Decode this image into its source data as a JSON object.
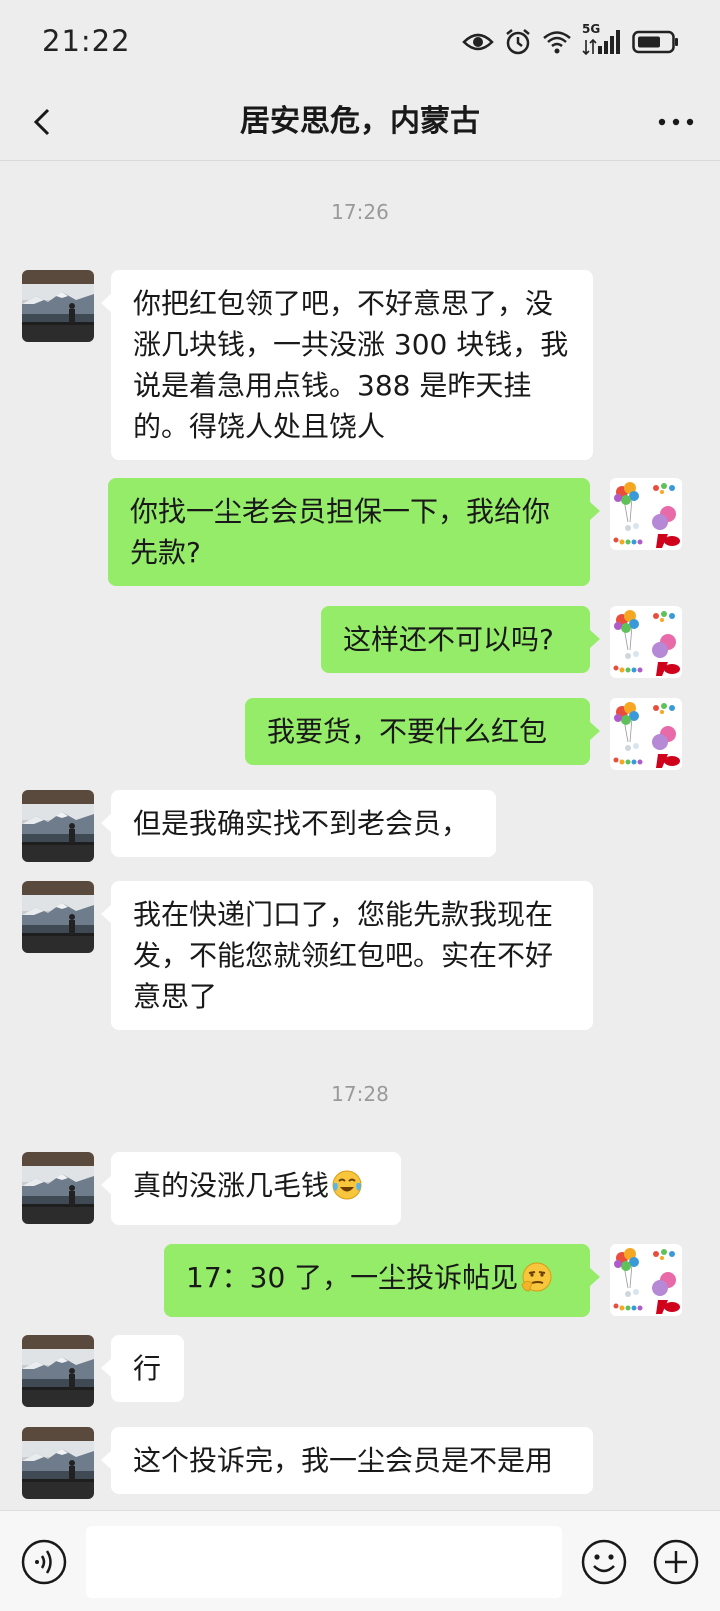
{
  "status_bar": {
    "time": "21:22",
    "network": "5G",
    "icons": [
      "eye-icon",
      "alarm-icon",
      "wifi-icon",
      "signal-icon",
      "battery-icon"
    ]
  },
  "header": {
    "title": "居安思危，内蒙古",
    "back_icon": "chevron-left-icon",
    "more_icon": "more-dots-icon"
  },
  "timestamps": [
    "17:26",
    "17:28"
  ],
  "messages": [
    {
      "side": "in",
      "text": "你把红包领了吧，不好意思了，没涨几块钱，一共没涨 300 块钱，我说是着急用点钱。388 是昨天挂的。得饶人处且饶人"
    },
    {
      "side": "out",
      "text": "你找一尘老会员担保一下，我给你先款?"
    },
    {
      "side": "out",
      "text": "这样还不可以吗?"
    },
    {
      "side": "out",
      "text": "我要货，不要什么红包"
    },
    {
      "side": "in",
      "text": "但是我确实找不到老会员，"
    },
    {
      "side": "in",
      "text": "我在快递门口了，您能先款我现在发，不能您就领红包吧。实在不好意思了"
    },
    {
      "side": "in",
      "text": "真的没涨几毛钱",
      "emoji": "crying-laughing-emoji"
    },
    {
      "side": "out",
      "text": "17：30 了，一尘投诉帖见",
      "emoji": "smirk-emoji"
    },
    {
      "side": "in",
      "text": "行"
    },
    {
      "side": "in",
      "text": "这个投诉完，我一尘会员是不是用"
    }
  ],
  "input_bar": {
    "placeholder": "",
    "voice_icon": "voice-icon",
    "emoji_icon": "smiley-icon",
    "plus_icon": "plus-icon"
  },
  "colors": {
    "background": "#ededed",
    "incoming_bubble": "#ffffff",
    "outgoing_bubble": "#95ec69",
    "text": "#191919",
    "timestamp": "#9a9a9a"
  }
}
